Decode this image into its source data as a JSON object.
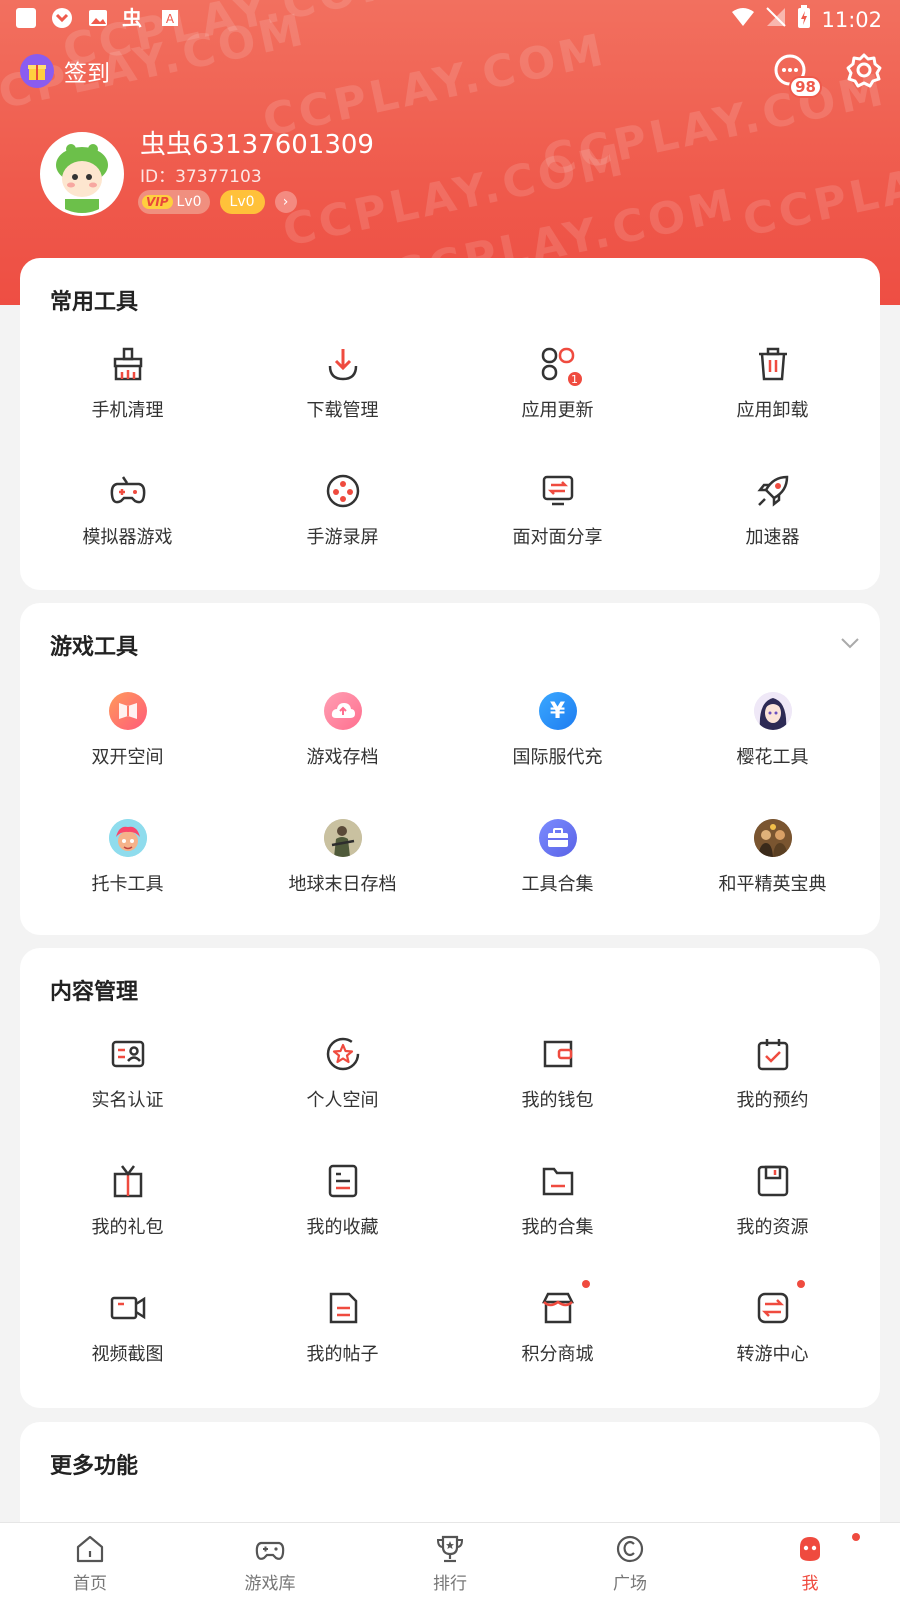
{
  "status_bar": {
    "time": "11:02"
  },
  "header": {
    "checkin_label": "签到",
    "message_count": "98",
    "username": "虫虫63137601309",
    "user_id": "ID：37377103",
    "vip_tag": "VIP",
    "vip_level": "Lv0",
    "level": "Lv0",
    "watermark": "CCPLAY.COM"
  },
  "sections": {
    "common_tools": {
      "title": "常用工具",
      "items": [
        {
          "label": "手机清理",
          "icon": "broom-icon"
        },
        {
          "label": "下载管理",
          "icon": "download-icon"
        },
        {
          "label": "应用更新",
          "icon": "app-update-icon",
          "badge": "1"
        },
        {
          "label": "应用卸载",
          "icon": "trash-icon"
        },
        {
          "label": "模拟器游戏",
          "icon": "gamepad-icon"
        },
        {
          "label": "手游录屏",
          "icon": "record-reel-icon"
        },
        {
          "label": "面对面分享",
          "icon": "share-screen-icon"
        },
        {
          "label": "加速器",
          "icon": "rocket-icon"
        }
      ]
    },
    "game_tools": {
      "title": "游戏工具",
      "items": [
        {
          "label": "双开空间",
          "icon": "dual-space-icon"
        },
        {
          "label": "游戏存档",
          "icon": "cloud-upload-icon"
        },
        {
          "label": "国际服代充",
          "icon": "yen-icon"
        },
        {
          "label": "樱花工具",
          "icon": "sakura-avatar-icon"
        },
        {
          "label": "托卡工具",
          "icon": "toca-avatar-icon"
        },
        {
          "label": "地球末日存档",
          "icon": "soldier-avatar-icon"
        },
        {
          "label": "工具合集",
          "icon": "toolbox-icon"
        },
        {
          "label": "和平精英宝典",
          "icon": "pubg-avatar-icon"
        }
      ]
    },
    "content_mgmt": {
      "title": "内容管理",
      "items": [
        {
          "label": "实名认证",
          "icon": "id-card-icon"
        },
        {
          "label": "个人空间",
          "icon": "star-circle-icon"
        },
        {
          "label": "我的钱包",
          "icon": "wallet-icon"
        },
        {
          "label": "我的预约",
          "icon": "calendar-check-icon"
        },
        {
          "label": "我的礼包",
          "icon": "gift-box-icon"
        },
        {
          "label": "我的收藏",
          "icon": "bookmark-list-icon"
        },
        {
          "label": "我的合集",
          "icon": "folder-icon"
        },
        {
          "label": "我的资源",
          "icon": "save-icon"
        },
        {
          "label": "视频截图",
          "icon": "video-camera-icon"
        },
        {
          "label": "我的帖子",
          "icon": "post-icon"
        },
        {
          "label": "积分商城",
          "icon": "store-icon",
          "dot": true
        },
        {
          "label": "转游中心",
          "icon": "transfer-icon",
          "dot": true
        }
      ]
    },
    "more": {
      "title": "更多功能"
    }
  },
  "tabbar": [
    {
      "label": "首页",
      "icon": "home-icon"
    },
    {
      "label": "游戏库",
      "icon": "gamepad-tab-icon"
    },
    {
      "label": "排行",
      "icon": "trophy-icon"
    },
    {
      "label": "广场",
      "icon": "plaza-icon"
    },
    {
      "label": "我",
      "icon": "me-icon",
      "active": true
    }
  ],
  "colors": {
    "accent": "#ef4b3f",
    "header": "#ef5a4c"
  }
}
